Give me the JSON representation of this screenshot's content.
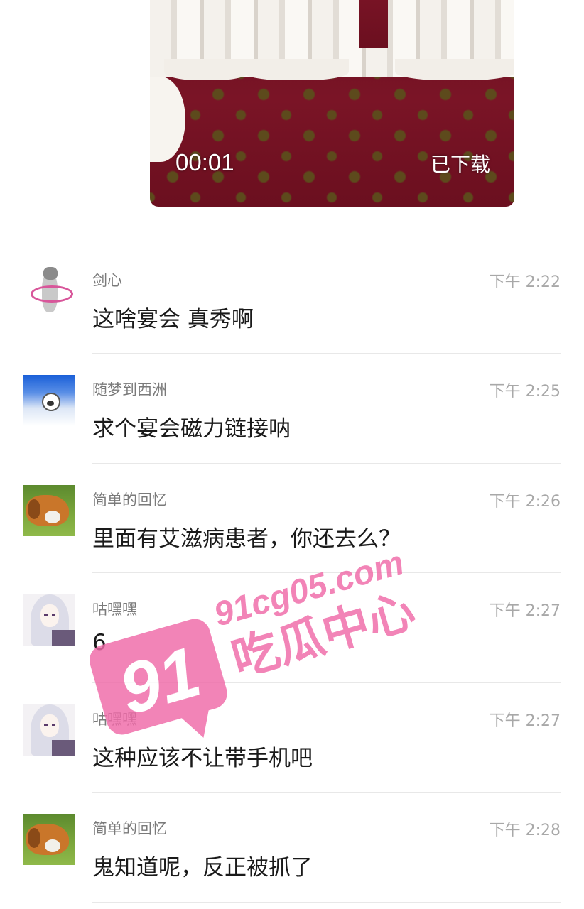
{
  "video": {
    "duration": "00:01",
    "status": "已下载"
  },
  "comments": [
    {
      "name": "剑心",
      "time": "下午 2:22",
      "text": "这啥宴会 真秀啊",
      "avatar": "cartoon-hula-hoop-avatar"
    },
    {
      "name": "随梦到西洲",
      "time": "下午 2:25",
      "text": "求个宴会磁力链接呐",
      "avatar": "blue-sky-face-avatar"
    },
    {
      "name": "简单的回忆",
      "time": "下午 2:26",
      "text": "里面有艾滋病患者，你还去么？",
      "avatar": "golden-retriever-avatar"
    },
    {
      "name": "咕嘿嘿",
      "time": "下午 2:27",
      "text": "6",
      "avatar": "anime-white-hair-avatar"
    },
    {
      "name": "咕嘿嘿",
      "time": "下午 2:27",
      "text": "这种应该不让带手机吧",
      "avatar": "anime-white-hair-avatar"
    },
    {
      "name": "简单的回忆",
      "time": "下午 2:28",
      "text": "鬼知道呢，反正被抓了",
      "avatar": "golden-retriever-avatar"
    }
  ],
  "watermark": {
    "badge": "91",
    "site": "91cg05.com",
    "brand": "吃瓜中心",
    "color": "#f06aa8"
  }
}
